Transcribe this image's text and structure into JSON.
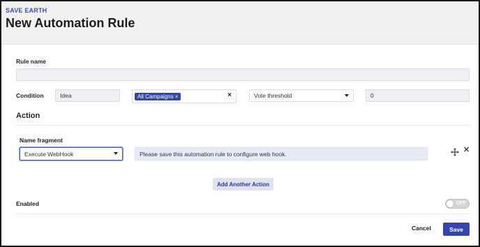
{
  "header": {
    "org_name": "SAVE EARTH",
    "title": "New Automation Rule"
  },
  "rule_name": {
    "label": "Rule name",
    "value": ""
  },
  "condition": {
    "label": "Condition",
    "type_value": "Idea",
    "campaign_tag": "All Campaigns",
    "tag_remove": "×",
    "clear": "×",
    "metric_value": "Vote threshold",
    "threshold_value": "0"
  },
  "action": {
    "section_title": "Action",
    "name_fragment_label": "Name fragment",
    "action_select_value": "Execute WebHook",
    "webhook_message": "Please save this automation rule to configure web hook.",
    "move_icon": "move-icon",
    "remove_icon": "close-icon",
    "add_another_label": "Add Another Action"
  },
  "enabled": {
    "label": "Enabled",
    "toggle_text": "OFF",
    "state": false
  },
  "footer": {
    "cancel_label": "Cancel",
    "save_label": "Save"
  },
  "colors": {
    "accent": "#3545b0",
    "org_text": "#3b4cc0"
  }
}
